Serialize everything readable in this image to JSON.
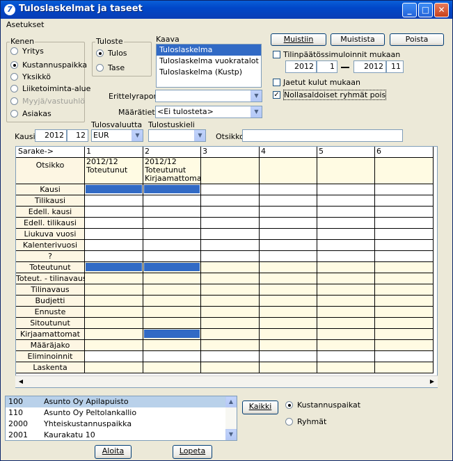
{
  "window": {
    "title": "Tuloslaskelmat ja taseet"
  },
  "menu": {
    "settings": "Asetukset"
  },
  "kenen": {
    "label": "Kenen",
    "options": [
      "Yritys",
      "Kustannuspaikka",
      "Yksikkö",
      "Liiketoiminta-alue",
      "Myyjä/vastuuhlö",
      "Asiakas"
    ],
    "selected": "Kustannuspaikka"
  },
  "tuloste": {
    "label": "Tuloste",
    "options": [
      "Tulos",
      "Tase"
    ],
    "selected": "Tulos"
  },
  "kaava": {
    "label": "Kaava",
    "items": [
      "Tuloslaskelma",
      "Tuloslaskelma vuokratalot uus",
      "Tuloslaskelma (Kustp)"
    ],
    "selected": "Tuloslaskelma"
  },
  "buttons": {
    "muistiin": "Muistiin",
    "muistista": "Muistista",
    "poista": "Poista",
    "kaikki": "Kaikki",
    "aloita": "Aloita",
    "lopeta": "Lopeta"
  },
  "tilinpaatos": {
    "label": "Tilinpäätössimuloinnit mukaan",
    "from_year": "2012",
    "from_month": "1",
    "to_year": "2012",
    "to_month": "11"
  },
  "checks": {
    "jaetut": "Jaetut kulut mukaan",
    "nollasaldoiset": "Nollasaldoiset ryhmät pois",
    "nollasaldoiset_checked": "✓"
  },
  "erittely": {
    "label": "Erittelyraportit",
    "value": ""
  },
  "maaratieto": {
    "label": "Määrätieto",
    "value": "<Ei tulosteta>"
  },
  "kausi": {
    "label": "Kausi",
    "year": "2012",
    "month": "12"
  },
  "tulosvaluutta": {
    "label": "Tulosvaluutta",
    "value": "EUR"
  },
  "tulostuskieli": {
    "label": "Tulostuskieli",
    "value": ""
  },
  "otsikko": {
    "label": "Otsikko",
    "value": ""
  },
  "grid": {
    "header_label": "Sarake->",
    "columns": [
      "1",
      "2",
      "3",
      "4",
      "5",
      "6"
    ],
    "otsikko_label": "Otsikko",
    "col1_title": [
      "2012/12",
      "Toteutunut"
    ],
    "col2_title": [
      "2012/12",
      "Toteutunut",
      "Kirjaamattomat"
    ],
    "rows": [
      "Kausi",
      "Tilikausi",
      "Edell. kausi",
      "Edell. tilikausi",
      "Liukuva vuosi",
      "Kalenterivuosi",
      "?",
      "Toteutunut",
      "Toteut. - tilinavaus",
      "Tilinavaus",
      "Budjetti",
      "Ennuste",
      "Sitoutunut",
      "Kirjaamattomat",
      "Määräjako",
      "Eliminoinnit",
      "Laskenta"
    ]
  },
  "units": {
    "items": [
      {
        "code": "100",
        "name": "Asunto Oy Apilapuisto"
      },
      {
        "code": "110",
        "name": "Asunto Oy Peltolankallio"
      },
      {
        "code": "2000",
        "name": "Yhteiskustannuspaikka"
      },
      {
        "code": "2001",
        "name": "Kaurakatu 10"
      }
    ],
    "selected_index": 0
  },
  "scope": {
    "options": [
      "Kustannuspaikat",
      "Ryhmät"
    ],
    "selected": "Kustannuspaikat"
  }
}
